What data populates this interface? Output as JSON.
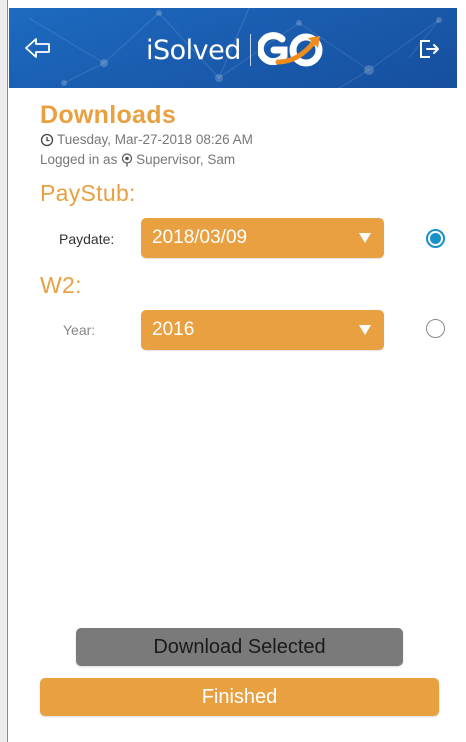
{
  "header": {
    "logo_text": "iSolved",
    "logo_mark_text": "GO",
    "colors": {
      "background": "#1a5db0",
      "accent": "#f08c1e"
    },
    "back_icon": "arrow-left-outline-icon",
    "logout_icon": "logout-icon"
  },
  "page": {
    "title": "Downloads",
    "datetime": "Tuesday, Mar-27-2018 08:26 AM",
    "logged_in_prefix": "Logged in as ",
    "logged_in_user": "Supervisor, Sam"
  },
  "paystub": {
    "section_title": "PayStub:",
    "field_label": "Paydate:",
    "selected_value": "2018/03/09",
    "selected": true
  },
  "w2": {
    "section_title": "W2:",
    "field_label": "Year:",
    "selected_value": "2016",
    "selected": false
  },
  "actions": {
    "download_label": "Download Selected",
    "finished_label": "Finished"
  },
  "theme": {
    "accent_orange": "#e8a040",
    "radio_blue": "#1890c8",
    "button_gray": "#7a7a7a"
  }
}
